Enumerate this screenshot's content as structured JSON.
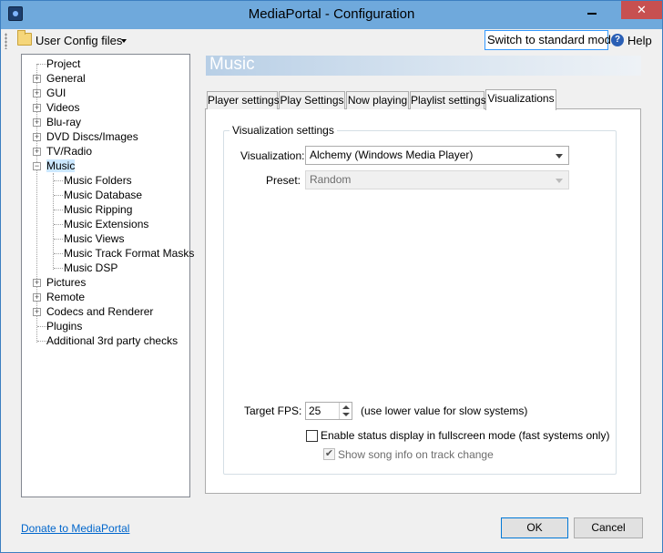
{
  "window": {
    "title": "MediaPortal - Configuration",
    "close_glyph": "✕"
  },
  "toolbar": {
    "user_config_label": "User Config files",
    "switch_mode_label": "Switch to standard mode",
    "help_label": "Help",
    "help_glyph": "?"
  },
  "tree": {
    "expander_glyph": "+",
    "collapse_glyph": "−",
    "items": [
      {
        "label": "Project"
      },
      {
        "label": "General"
      },
      {
        "label": "GUI"
      },
      {
        "label": "Videos"
      },
      {
        "label": "Blu-ray"
      },
      {
        "label": "DVD Discs/Images"
      },
      {
        "label": "TV/Radio"
      },
      {
        "label": "Music"
      },
      {
        "label": "Music Folders"
      },
      {
        "label": "Music Database"
      },
      {
        "label": "Music Ripping"
      },
      {
        "label": "Music Extensions"
      },
      {
        "label": "Music Views"
      },
      {
        "label": "Music Track Format Masks"
      },
      {
        "label": "Music DSP"
      },
      {
        "label": "Pictures"
      },
      {
        "label": "Remote"
      },
      {
        "label": "Codecs and Renderer"
      },
      {
        "label": "Plugins"
      },
      {
        "label": "Additional 3rd party checks"
      }
    ]
  },
  "panel": {
    "header": "Music",
    "tabs": [
      {
        "label": "Player settings"
      },
      {
        "label": "Play Settings"
      },
      {
        "label": "Now playing"
      },
      {
        "label": "Playlist settings"
      },
      {
        "label": "Visualizations"
      }
    ],
    "group_title": "Visualization settings",
    "visualization_label": "Visualization:",
    "visualization_value": "Alchemy (Windows Media Player)",
    "preset_label": "Preset:",
    "preset_value": "Random",
    "fps_label": "Target FPS:",
    "fps_value": "25",
    "fps_hint": "(use lower value for slow systems)",
    "status_display_label": "Enable status display in fullscreen mode (fast systems only)",
    "song_info_label": "Show song info on track change",
    "song_info_check": "✔"
  },
  "footer": {
    "donate_label": "Donate to MediaPortal",
    "ok_label": "OK",
    "cancel_label": "Cancel"
  }
}
